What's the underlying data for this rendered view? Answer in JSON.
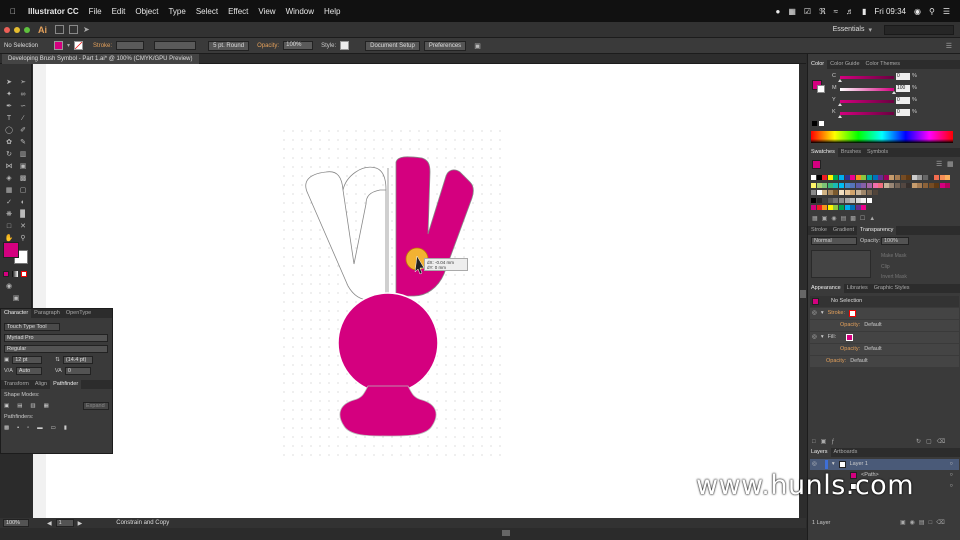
{
  "menubar": {
    "app": "Illustrator CC",
    "items": [
      "File",
      "Edit",
      "Object",
      "Type",
      "Select",
      "Effect",
      "View",
      "Window",
      "Help"
    ],
    "clock": "Fri 09:34"
  },
  "appbar": {
    "logo": "Ai",
    "workspace": "Essentials"
  },
  "controlbar": {
    "selection": "No Selection",
    "stroke_label": "Stroke:",
    "stroke_profile": "5 pt. Round",
    "opacity_label": "Opacity:",
    "opacity": "100%",
    "style_label": "Style:",
    "document_setup": "Document Setup",
    "preferences": "Preferences",
    "fill_color": "#d4007f"
  },
  "document": {
    "tab": "Developing Brush Symbol - Part 1.ai* @ 100% (CMYK/GPU Preview)"
  },
  "canvas": {
    "tooltip_line1": "dX: -0.04 mm",
    "tooltip_line2": "dY: 0 mm",
    "art_color": "#d4007f",
    "cursor_color": "#f2b233"
  },
  "statusbar": {
    "zoom": "100%",
    "page": "1",
    "mode": "Constrain and Copy"
  },
  "character_panel": {
    "tabs": [
      "Character",
      "Paragraph",
      "OpenType"
    ],
    "touch_type": "Touch Type Tool",
    "font": "Myriad Pro",
    "style": "Regular",
    "size": "12 pt",
    "leading": "(14.4 pt)",
    "kerning": "Auto",
    "tracking": "0"
  },
  "pathfinder_panel": {
    "tabs": [
      "Transform",
      "Align",
      "Pathfinder"
    ],
    "shape_modes": "Shape Modes:",
    "expand": "Expand",
    "pathfinders": "Pathfinders:"
  },
  "color_panel": {
    "tabs": [
      "Color",
      "Color Guide",
      "Color Themes"
    ],
    "channels": [
      {
        "label": "C",
        "value": "0",
        "fill": 0
      },
      {
        "label": "M",
        "value": "100",
        "fill": 1
      },
      {
        "label": "Y",
        "value": "0",
        "fill": 0
      },
      {
        "label": "K",
        "value": "0",
        "fill": 0
      }
    ]
  },
  "swatches_panel": {
    "tabs": [
      "Swatches",
      "Brushes",
      "Symbols"
    ]
  },
  "transparency_panel": {
    "tabs": [
      "Stroke",
      "Gradient",
      "Transparency"
    ],
    "blend_mode": "Normal",
    "opacity_label": "Opacity:",
    "opacity": "100%",
    "make_mask": "Make Mask",
    "clip": "Clip",
    "invert_mask": "Invert Mask"
  },
  "appearance_panel": {
    "tabs": [
      "Appearance",
      "Libraries",
      "Graphic Styles"
    ],
    "title": "No Selection",
    "stroke": "Stroke:",
    "opacity1": "Opacity:",
    "default1": "Default",
    "fill": "Fill:",
    "opacity2": "Opacity:",
    "default2": "Default",
    "opacity3": "Opacity:",
    "default3": "Default"
  },
  "layers_panel": {
    "tabs": [
      "Layers",
      "Artboards"
    ],
    "layer": "Layer 1",
    "path": "<Path>",
    "count": "1 Layer"
  },
  "watermark": "www.hunls.com"
}
